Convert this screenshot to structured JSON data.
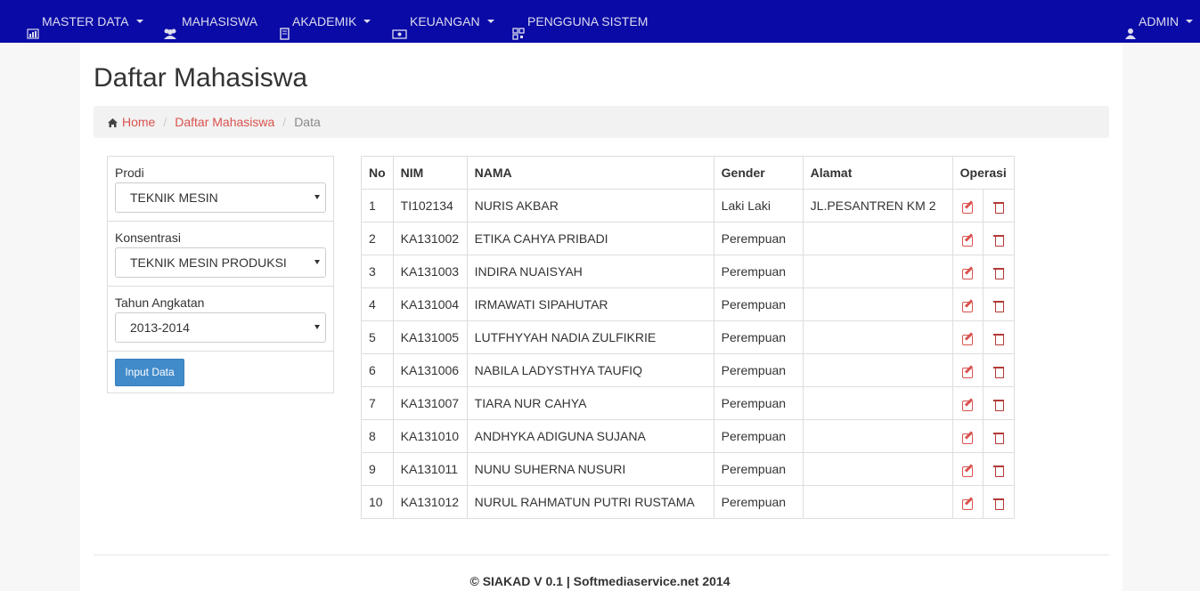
{
  "navbar": {
    "items": [
      {
        "label": "MASTER DATA",
        "icon": "bar-chart-icon",
        "dropdown": true
      },
      {
        "label": "MAHASISWA",
        "icon": "users-icon",
        "dropdown": false
      },
      {
        "label": "AKADEMIK",
        "icon": "book-icon",
        "dropdown": true
      },
      {
        "label": "KEUANGAN",
        "icon": "money-icon",
        "dropdown": true
      },
      {
        "label": "PENGGUNA SISTEM",
        "icon": "qrcode-icon",
        "dropdown": false
      }
    ],
    "user": {
      "label": "ADMIN",
      "icon": "user-icon"
    }
  },
  "page": {
    "title": "Daftar Mahasiswa"
  },
  "breadcrumb": {
    "home": "Home",
    "list": "Daftar Mahasiswa",
    "current": "Data",
    "sep": "/"
  },
  "filters": {
    "prodi": {
      "label": "Prodi",
      "value": "TEKNIK MESIN"
    },
    "konsentrasi": {
      "label": "Konsentrasi",
      "value": "TEKNIK MESIN PRODUKSI"
    },
    "tahun": {
      "label": "Tahun Angkatan",
      "value": "2013-2014"
    },
    "submit_label": "Input Data"
  },
  "table": {
    "headers": {
      "no": "No",
      "nim": "NIM",
      "nama": "NAMA",
      "gender": "Gender",
      "alamat": "Alamat",
      "operasi": "Operasi"
    },
    "rows": [
      {
        "no": "1",
        "nim": "TI102134",
        "nama": "NURIS AKBAR",
        "gender": "Laki Laki",
        "alamat": "JL.PESANTREN KM 2"
      },
      {
        "no": "2",
        "nim": "KA131002",
        "nama": "ETIKA CAHYA PRIBADI",
        "gender": "Perempuan",
        "alamat": ""
      },
      {
        "no": "3",
        "nim": "KA131003",
        "nama": "INDIRA NUAISYAH",
        "gender": "Perempuan",
        "alamat": ""
      },
      {
        "no": "4",
        "nim": "KA131004",
        "nama": "IRMAWATI SIPAHUTAR",
        "gender": "Perempuan",
        "alamat": ""
      },
      {
        "no": "5",
        "nim": "KA131005",
        "nama": "LUTFHYYAH NADIA ZULFIKRIE",
        "gender": "Perempuan",
        "alamat": ""
      },
      {
        "no": "6",
        "nim": "KA131006",
        "nama": "NABILA LADYSTHYA TAUFIQ",
        "gender": "Perempuan",
        "alamat": ""
      },
      {
        "no": "7",
        "nim": "KA131007",
        "nama": "TIARA NUR CAHYA",
        "gender": "Perempuan",
        "alamat": ""
      },
      {
        "no": "8",
        "nim": "KA131010",
        "nama": "ANDHYKA ADIGUNA SUJANA",
        "gender": "Perempuan",
        "alamat": ""
      },
      {
        "no": "9",
        "nim": "KA131011",
        "nama": "NUNU SUHERNA NUSURI",
        "gender": "Perempuan",
        "alamat": ""
      },
      {
        "no": "10",
        "nim": "KA131012",
        "nama": "NURUL RAHMATUN PUTRI RUSTAMA",
        "gender": "Perempuan",
        "alamat": ""
      }
    ]
  },
  "footer": {
    "text": "© SIAKAD V 0.1 | Softmediaservice.net 2014"
  },
  "colors": {
    "navbar": "#0a0aa6",
    "link": "#d9534f",
    "primary_button": "#428bca"
  }
}
